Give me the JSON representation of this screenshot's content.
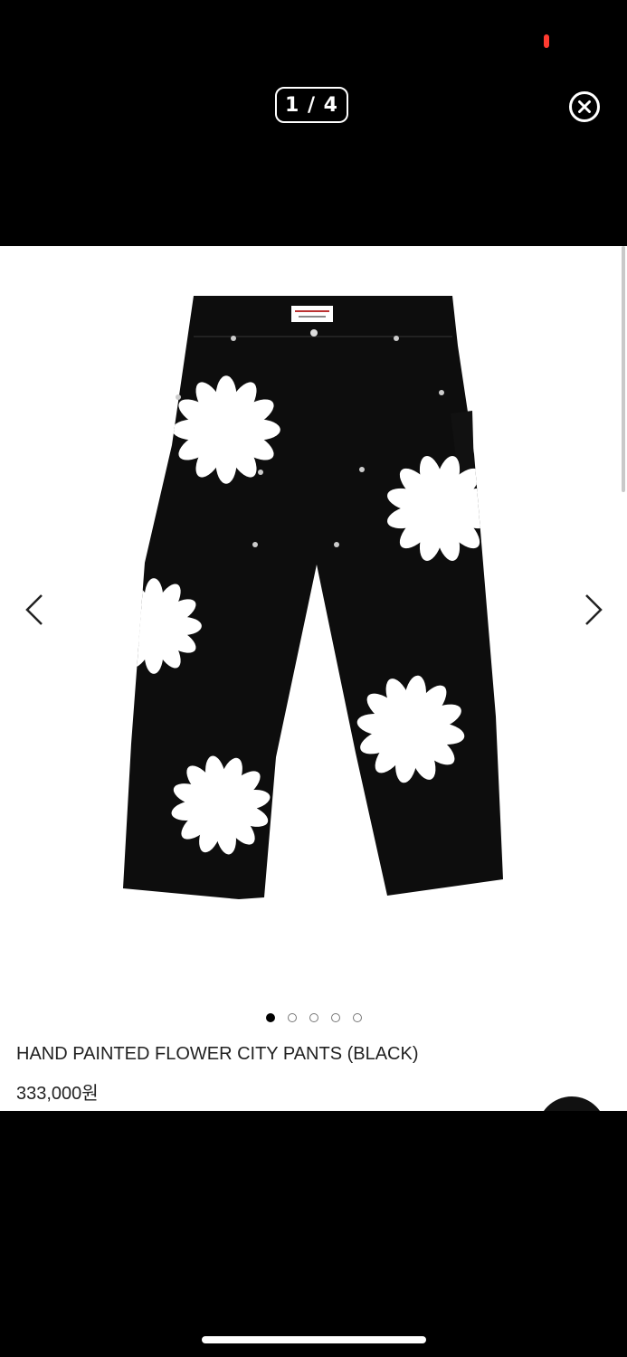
{
  "viewer": {
    "counter": "1 / 4"
  },
  "product": {
    "title": "HAND PAINTED FLOWER CITY PANTS (BLACK)",
    "price": "333,000원",
    "image_icon": "pants-image",
    "carousel_dots": 5,
    "active_dot": 0
  },
  "icons": {
    "close": "close-icon",
    "prev": "chevron-left-icon",
    "next": "chevron-right-icon"
  },
  "colors": {
    "background": "#000000",
    "sheet": "#ffffff",
    "status_dot": "#ff3b30"
  }
}
